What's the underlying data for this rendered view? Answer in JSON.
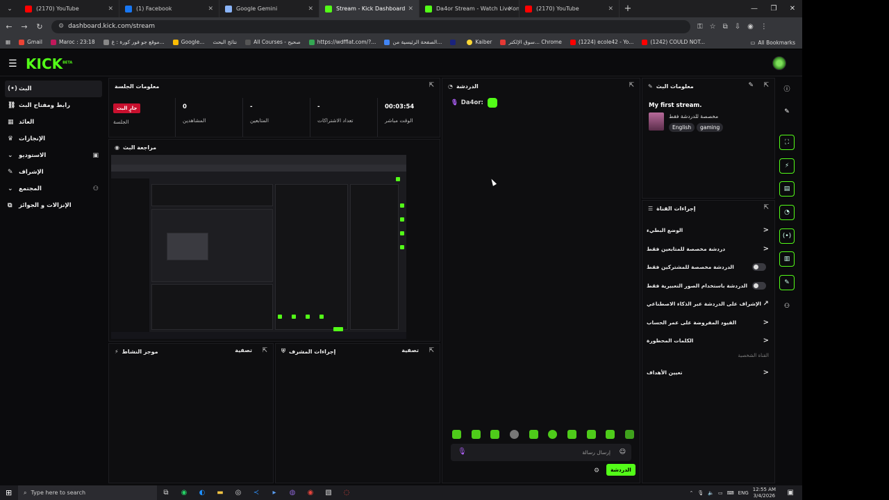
{
  "browser": {
    "tabs": [
      {
        "label": "(2170) YouTube",
        "color": "#ff0000"
      },
      {
        "label": "(1) Facebook",
        "color": "#1877f2"
      },
      {
        "label": "Google Gemini",
        "color": "#8ab4f8"
      },
      {
        "label": "Stream - Kick Dashboard",
        "color": "#53fc18",
        "active": true
      },
      {
        "label": "Da4or Stream - Watch Live on K",
        "color": "#53fc18"
      },
      {
        "label": "(2170) YouTube",
        "color": "#ff0000"
      }
    ],
    "url": "dashboard.kick.com/stream",
    "bookmarks": [
      "Gmail",
      "Maroc : 23:18",
      "موقع جو فور كورة : غ...",
      "Google...",
      "نتائج البحث",
      "All Courses - صحيح",
      "https://wdfflat.com/?...",
      "الصفحة الرئيسية من...",
      "Kaiber",
      "سوق الإلكتر... Chrome",
      "(1224) ecole42 - Yo...",
      "(1242) COULD NOT..."
    ],
    "all_bookmarks": "All Bookmarks"
  },
  "kick": {
    "logo": "KICK",
    "logo_sup": "BETA",
    "nav": [
      {
        "label": "البث",
        "icon": "(•)",
        "selected": true
      },
      {
        "label": "رابط ومفتاح البث",
        "icon": "⛓"
      },
      {
        "label": "العائد",
        "icon": "▦"
      },
      {
        "label": "الإنجازات",
        "icon": "🏆"
      },
      {
        "label": "الاستوديو",
        "icon": "⌄",
        "badge": "▣"
      },
      {
        "label": "الإشراف",
        "icon": "✎"
      },
      {
        "label": "المجتمع",
        "icon": "⌄",
        "badge": "⚇"
      },
      {
        "label": "الإنزالات و الجوائز",
        "icon": "⧉"
      }
    ],
    "session": {
      "title": "معلومات الجلسة",
      "badge": "جارٍ البث",
      "badge_label": "الجلسة",
      "stats": [
        {
          "value": "0",
          "label": "المشاهدين"
        },
        {
          "value": "-",
          "label": "المتابعين"
        },
        {
          "value": "-",
          "label": "تعداد الاشتراكات"
        },
        {
          "value": "00:03:54",
          "label": "الوقت مباشر"
        }
      ]
    },
    "preview_title": "مراجعة البث",
    "activity": {
      "title": "موجز النشاط",
      "filter": "تصفية"
    },
    "modactions": {
      "title": "إجراءات المشرف",
      "filter": "تصفية"
    },
    "chat": {
      "title": "الدردشة",
      "user": "Da4or:",
      "placeholder": "إرسال رسالة",
      "send": "الدردشة"
    },
    "streaminfo": {
      "title": "معلومات البث",
      "stream_title": "My first stream.",
      "category": "مخصصة للدردشة فقط",
      "tags": [
        "English",
        "gaming"
      ]
    },
    "channel": {
      "title": "إجراءات القناة",
      "items": [
        {
          "label": "الوضع البطيء",
          "kind": "chev"
        },
        {
          "label": "دردشة مخصصة للمتابعين فقط",
          "kind": "chev"
        },
        {
          "label": "الدردشة مخصصة للمشتركين فقط",
          "kind": "toggle"
        },
        {
          "label": "الدردشة باستخدام الصور التعبيرية فقط",
          "kind": "toggle"
        },
        {
          "label": "الإشراف على الدردشة عبر الذكاء الاصطناعي",
          "kind": "link"
        },
        {
          "label": "القيود المفروضة على عمر الحساب",
          "kind": "chev"
        },
        {
          "label": "الكلمات المحظورة",
          "kind": "chev"
        }
      ],
      "sub": "القناة الشخصية",
      "goals": "تعيين الأهداف"
    }
  },
  "taskbar": {
    "search": "Type here to search",
    "lang": "ENG",
    "time": "12:55 AM",
    "date": "3/4/2026"
  }
}
